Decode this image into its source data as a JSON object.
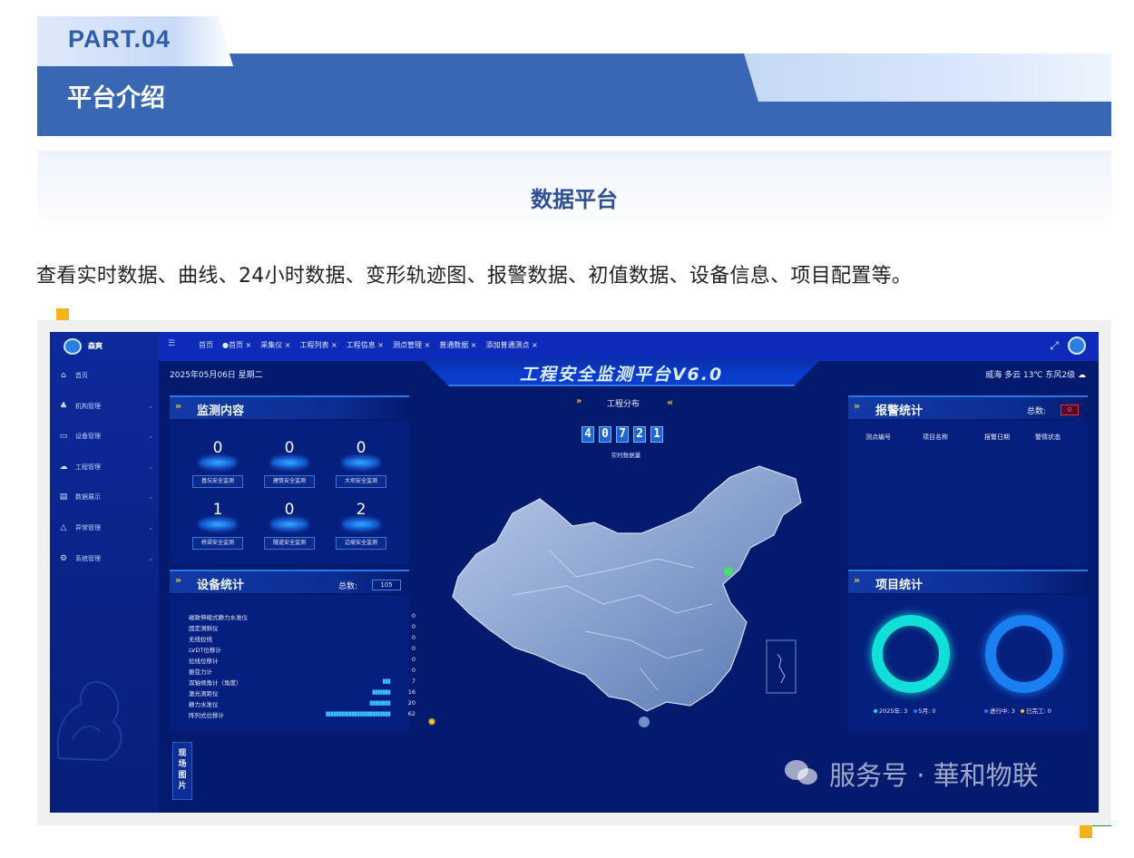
{
  "header": {
    "part_label": "PART.04",
    "section_title": "平台介绍",
    "subtitle": "数据平台",
    "description": "查看实时数据、曲线、24小时数据、变形轨迹图、报警数据、初值数据、设备信息、项目配置等。"
  },
  "colors": {
    "banner_blue": "#3a67b3",
    "accent_gold": "#f0c040",
    "accent_green": "#1f8f4a",
    "accent_orange": "#f5b21b",
    "dashboard_bg": "#041a6e",
    "ring_teal": "#10e0d8",
    "ring_blue": "#1a7ff0"
  },
  "screenshot": {
    "sidebar": {
      "brand": "森爽",
      "items": [
        {
          "label": "首页",
          "icon": "dashboard-icon"
        },
        {
          "label": "机构管理",
          "icon": "org-tree-icon"
        },
        {
          "label": "设备管理",
          "icon": "monitor-icon"
        },
        {
          "label": "工程管理",
          "icon": "cloud-icon"
        },
        {
          "label": "数据展示",
          "icon": "book-icon"
        },
        {
          "label": "异常管理",
          "icon": "warning-icon"
        },
        {
          "label": "系统管理",
          "icon": "gear-icon"
        }
      ]
    },
    "topbar": {
      "tabs": [
        "首页",
        "●首页 ×",
        "采集仪 ×",
        "工程列表 ×",
        "工程信息 ×",
        "测点管理 ×",
        "普通数据 ×",
        "添加普通测点 ×"
      ]
    },
    "date": "2025年05月06日 星期二",
    "weather": "威海 多云 13℃ 东风2级",
    "platform_title": "工程安全监测平台V6.0",
    "monitor": {
      "title": "监测内容",
      "items": [
        {
          "value": "0",
          "label": "基坑安全监测"
        },
        {
          "value": "0",
          "label": "建筑安全监测"
        },
        {
          "value": "0",
          "label": "大坝安全监测"
        },
        {
          "value": "1",
          "label": "桥梁安全监测"
        },
        {
          "value": "0",
          "label": "隧道安全监测"
        },
        {
          "value": "2",
          "label": "边坡安全监测"
        }
      ]
    },
    "devices": {
      "title": "设备统计",
      "total_label": "总数:",
      "total": "105",
      "rows": [
        {
          "name": "磁致伸缩式静力水准仪",
          "bars": "",
          "value": "0"
        },
        {
          "name": "固定测斜仪",
          "bars": "",
          "value": "0"
        },
        {
          "name": "无线拉线",
          "bars": "",
          "value": "0"
        },
        {
          "name": "LVDT位移计",
          "bars": "",
          "value": "0"
        },
        {
          "name": "拉线位移计",
          "bars": "",
          "value": "0"
        },
        {
          "name": "振弦力计",
          "bars": "",
          "value": "0"
        },
        {
          "name": "双轴倾角计（角度）",
          "bars": "▮▮▮",
          "value": "7"
        },
        {
          "name": "激光测距仪",
          "bars": "▮▮▮▮▮▮▮",
          "value": "16"
        },
        {
          "name": "静力水准仪",
          "bars": "▮▮▮▮▮▮▮▮",
          "value": "20"
        },
        {
          "name": "阵列式位移计",
          "bars": "▮▮▮▮▮▮▮▮▮▮▮▮▮▮▮▮▮▮▮▮▮▮▮▮▮",
          "value": "62"
        }
      ]
    },
    "distribution": {
      "title": "工程分布",
      "digits": [
        "4",
        "0",
        "7",
        "2",
        "1"
      ],
      "digits_label": "实时数据量"
    },
    "alarm": {
      "title": "报警统计",
      "total_label": "总数:",
      "total": "0",
      "columns": [
        "测点编号",
        "项目名称",
        "报警日期",
        "警情状态"
      ]
    },
    "project": {
      "title": "项目统计",
      "legend_left": [
        "2025年: 3",
        "5月: 0"
      ],
      "legend_right": [
        "进行中: 3",
        "已完工: 0"
      ]
    },
    "side_tab": "现场图片",
    "watermark": "服务号 · 華和物联"
  }
}
